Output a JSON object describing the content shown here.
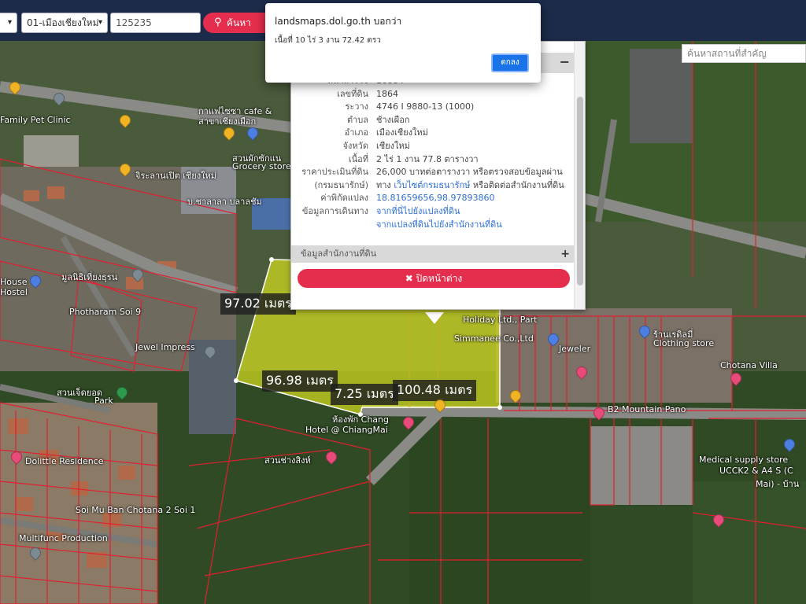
{
  "topbar": {
    "province_select": "",
    "district_select": "01-เมืองเชียงใหม่",
    "parcel_input": "125235",
    "search_label": "ค้นหา"
  },
  "map": {
    "search_placeholder": "ค้นหาสถานที่สำคัญ",
    "measurements": [
      "97.02 เมตร",
      "96.98 เมตร",
      "7.25 เมตร",
      "100.48 เมตร"
    ],
    "places": [
      "Family Pet Clinic",
      "กาแฟไซซา cafe &",
      "สาขาเชียงเผือก",
      "สวนผักซักแน",
      "Grocery store",
      "จิระลานเปิต เชียงใหม่",
      "บ.ชาลาลา บลาลชัม",
      "House",
      "Hostel",
      "มูลนิธิเที่ยงธุรน",
      "Photharam Soi 9",
      "Jewel Impress",
      "สวนเจ็ดยอด",
      "Park",
      "Holiday Ltd., Part",
      "Simmanee Co.,Ltd",
      "Jeweler",
      "ร้านเรดิลมี่",
      "Clothing store",
      "Chotana Villa",
      "B2 Mountain Pano",
      "ห้องพัก Chang",
      "Hotel @ ChiangMai",
      "สวนช่างสิงห์",
      "Dolittle Residence",
      "Soi Mu Ban Chotana 2 Soi 1",
      "Multifunc Production",
      "Medical supply store",
      "UCCK2 & A4 S (C",
      "Mai) - บ้าน"
    ]
  },
  "panel": {
    "rows": [
      {
        "k": "หน้าสำรวจ",
        "v": "16884"
      },
      {
        "k": "เลขที่ดิน",
        "v": "1864"
      },
      {
        "k": "ระวาง",
        "v": "4746 I 9880-13 (1000)"
      },
      {
        "k": "ตำบล",
        "v": "ช้างเผือก"
      },
      {
        "k": "อำเภอ",
        "v": "เมืองเชียงใหม่"
      },
      {
        "k": "จังหวัด",
        "v": "เชียงใหม่"
      },
      {
        "k": "เนื้อที่",
        "v": "2 ไร่ 1 งาน 77.8 ตารางวา"
      },
      {
        "k": "ราคาประเมินที่ดิน",
        "v": "26,000 บาทต่อตารางวา หรือตรวจสอบข้อมูลผ่าน"
      },
      {
        "k": "(กรมธนารักษ์)",
        "v": "ทาง",
        "link": "เว็บไซต์กรมธนารักษ์",
        "tail": "หรือติดต่อสำนักงานที่ดิน"
      },
      {
        "k": "ค่าพิกัดแปลง",
        "v": "18.81659656,98.97893860",
        "is_link": true
      },
      {
        "k": "ข้อมูลการเดินทาง",
        "v": "จากที่นี่ไปยังแปลงที่ดิน",
        "is_link": true
      },
      {
        "k": "",
        "v": "จากแปลงที่ดินไปยังสำนักงานที่ดิน",
        "is_link": true
      }
    ],
    "office_label": "ข้อมูลสำนักงานที่ดิน",
    "close_label": "✖ ปิดหน้าต่าง"
  },
  "alert": {
    "title": "landsmaps.dol.go.th บอกว่า",
    "message": "เนื้อที่ 10 ไร่ 3 งาน 72.42 ตรว",
    "ok_label": "ตกลง"
  },
  "colors": {
    "topbar": "#1d2b4a",
    "accent_red": "#e52e4d",
    "parcel_fill": "#d4dc1e",
    "parcel_line": "#e02030",
    "link": "#2f6fd3"
  }
}
